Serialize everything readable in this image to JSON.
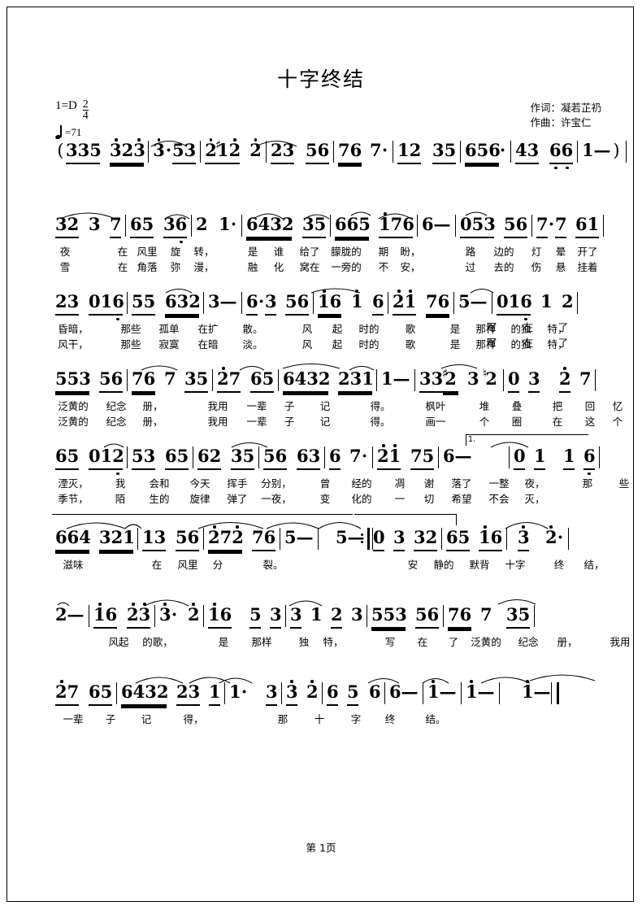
{
  "document": {
    "title": "十字终结",
    "key_signature": "1=D",
    "meter_numerator": "2",
    "meter_denominator": "4",
    "tempo_label": "=71",
    "lyricist": "作词：凝若芷礽",
    "composer": "作曲：许宝仁",
    "footer": "第 1页"
  },
  "score": {
    "lines": [
      {
        "id": "line-1",
        "label": "intro",
        "notes": "( 335 323 | 3 · 53 | 2 #12 2 | 23 56 | 76 7 · | 12 35 | 656 · | 43 66 | 1 — )",
        "lyrics_verse1": "",
        "lyrics_verse2": ""
      },
      {
        "id": "line-2",
        "notes": "32 3 7 | 65 36 | 2 1 · | 6432 35 | 665 176 | 6 — | 053 56 | 7 · 7 61 |",
        "lyrics_verse1": "夜 在 风里 旋 转， 是 谁 给了 朦胧的 期 盼， 路 边的 灯 晕 开了",
        "lyrics_verse2": "雪 在 角落 弥 漫， 融 化 窝在 一旁的 不 安， 过 去的 伤 悬 挂着"
      },
      {
        "id": "line-3",
        "notes": "23 016 | 55 632 | 3 — | 6 · 3 56 | 16 1 6 | 21 76 | 5 — | 016 1 2 |",
        "lyrics_verse1": "昏暗， 那些 孤单 在扩 散。 风 起 时的 歌 是 那样 的独 特， 写 在 了",
        "lyrics_verse2": "风干， 那些 寂寞 在暗 淡。 风 起 时的 歌 是 那样 的独 特， 写 在 了"
      },
      {
        "id": "line-4",
        "notes": "553 56 | 76 7 35 | 27 65 | 6432 231 | 1 — | 33 #2 3 ♮2 | 0 3 2 7 |",
        "lyrics_verse1": "泛黄的 纪念 册， 我用 一辈 子 记 得。 枫叶 堆 叠 把 回 忆",
        "lyrics_verse2": "泛黄的 纪念 册， 我用 一辈 子 记 得。 画一 个 圈 在 这 个"
      },
      {
        "id": "line-5",
        "notes": "65 012 | 53 65 | 62 35 | 56 63 | 6 7 · | 21 75 | 6 — | [1.] 0 1 1 6 |",
        "lyrics_verse1": "湮灭， 我 会和 今天 挥手 分别， 曾 经的 凋 谢 落了 一整 夜， 那 些",
        "lyrics_verse2": "季节， 陌 生的 旋律 弹了 一夜， 变 化的 一 切 希望 不会 灭，"
      },
      {
        "id": "line-6",
        "notes": "664 321 | 13 56 | 272 76 | 5 — | 5 — :‖ [2.] 0 3 32 | 65 16 | 3 2 · |",
        "lyrics_verse1": "滋味 在 风里 分 裂。 安 静的 默背 十字 终 结，",
        "lyrics_verse2": ""
      },
      {
        "id": "line-7",
        "notes": "2 — | 16 23 | 3 · 2 | 16 5 3 | 3 1 2 3 | 553 56 | 76 7 35 |",
        "lyrics_verse1": "风起 的歌， 是 那样 独 特， 写 在 了 泛黄的 纪念 册， 我用",
        "lyrics_verse2": ""
      },
      {
        "id": "line-8",
        "notes": "27 65 | 6432 23 1 | 1 · 3 | 3 2 | 6 5 6 | 6 — | 1 — | 1 — | 1 — ‖",
        "lyrics_verse1": "一辈 子 记 得， 那 十 字 终 结。",
        "lyrics_verse2": ""
      }
    ]
  }
}
